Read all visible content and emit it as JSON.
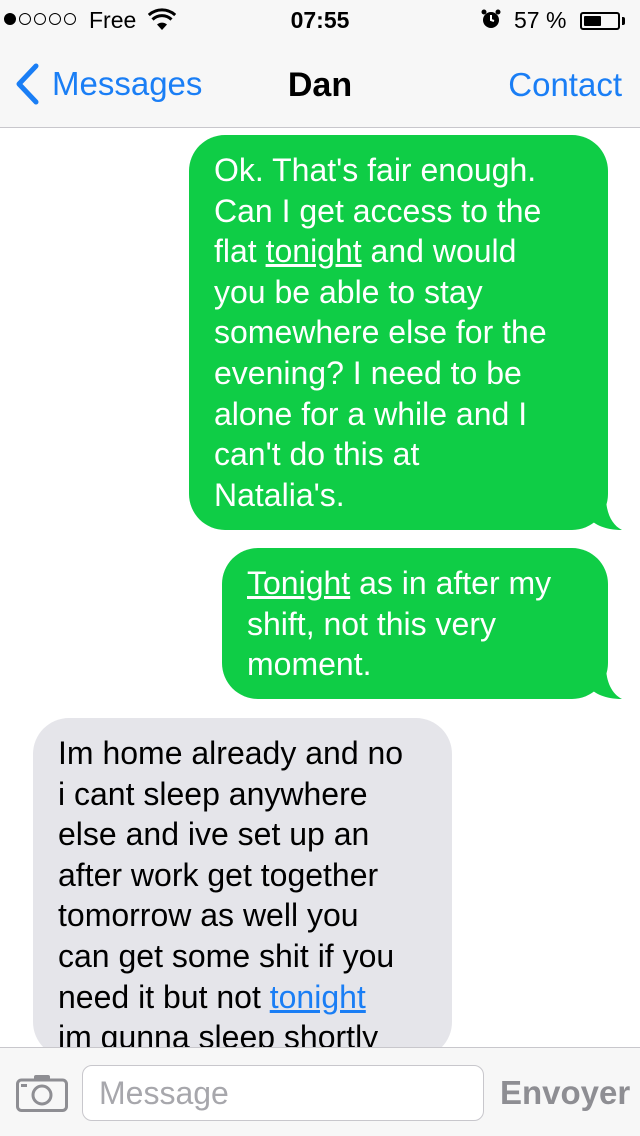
{
  "status_bar": {
    "carrier": "Free",
    "signal_strength": 1,
    "time": "07:55",
    "battery_percent": "57 %",
    "battery_level": 0.57,
    "icons": [
      "signal-dots-icon",
      "wifi-icon",
      "alarm-icon",
      "battery-icon"
    ]
  },
  "nav": {
    "back_label": "Messages",
    "title": "Dan",
    "contact_label": "Contact"
  },
  "messages": [
    {
      "direction": "sent",
      "parts": [
        {
          "text": "Ok.  That's fair enough.\nCan I get access to the\nflat "
        },
        {
          "text": "tonight",
          "link": true
        },
        {
          "text": " and would\nyou be able to stay\nsomewhere else for the\nevening?  I need to be\nalone for a while and I\ncan't do this at\nNatalia's."
        }
      ]
    },
    {
      "direction": "sent",
      "parts": [
        {
          "text": "Tonight",
          "link": true
        },
        {
          "text": " as in after my\nshift, not this very\nmoment."
        }
      ]
    },
    {
      "direction": "received",
      "parts": [
        {
          "text": "Im home already and no\ni cant sleep anywhere\nelse and ive set up an\nafter work get together\ntomorrow as well you\ncan get some shit if you\nneed it but not "
        },
        {
          "text": "tonight",
          "link": true
        },
        {
          "text": "\nim gunna sleep shortly"
        }
      ]
    }
  ],
  "input_bar": {
    "placeholder": "Message",
    "send_label": "Envoyer"
  },
  "colors": {
    "sent_bubble": "#0fcd46",
    "received_bubble": "#e5e5ea",
    "accent": "#1a7ef5",
    "bar_background": "#f7f7f7"
  }
}
